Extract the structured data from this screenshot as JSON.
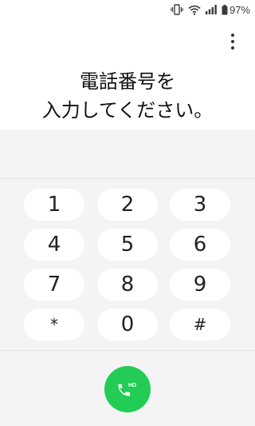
{
  "status_bar": {
    "battery_percent": "97%",
    "icons": [
      "vibrate-icon",
      "wifi-icon",
      "signal-icon",
      "battery-icon"
    ]
  },
  "menu": {
    "icon": "more-vertical-icon"
  },
  "prompt": {
    "line1": "電話番号を",
    "line2": "入力してください。"
  },
  "keypad": {
    "keys": [
      "1",
      "2",
      "3",
      "4",
      "5",
      "6",
      "7",
      "8",
      "9",
      "*",
      "0",
      "#"
    ]
  },
  "call_button": {
    "icon": "hd-phone-icon",
    "badge": "HD",
    "color": "#22cc55"
  },
  "colors": {
    "accent": "#22cc55",
    "dial_background": "#f4f4f4",
    "key_background": "#ffffff"
  }
}
